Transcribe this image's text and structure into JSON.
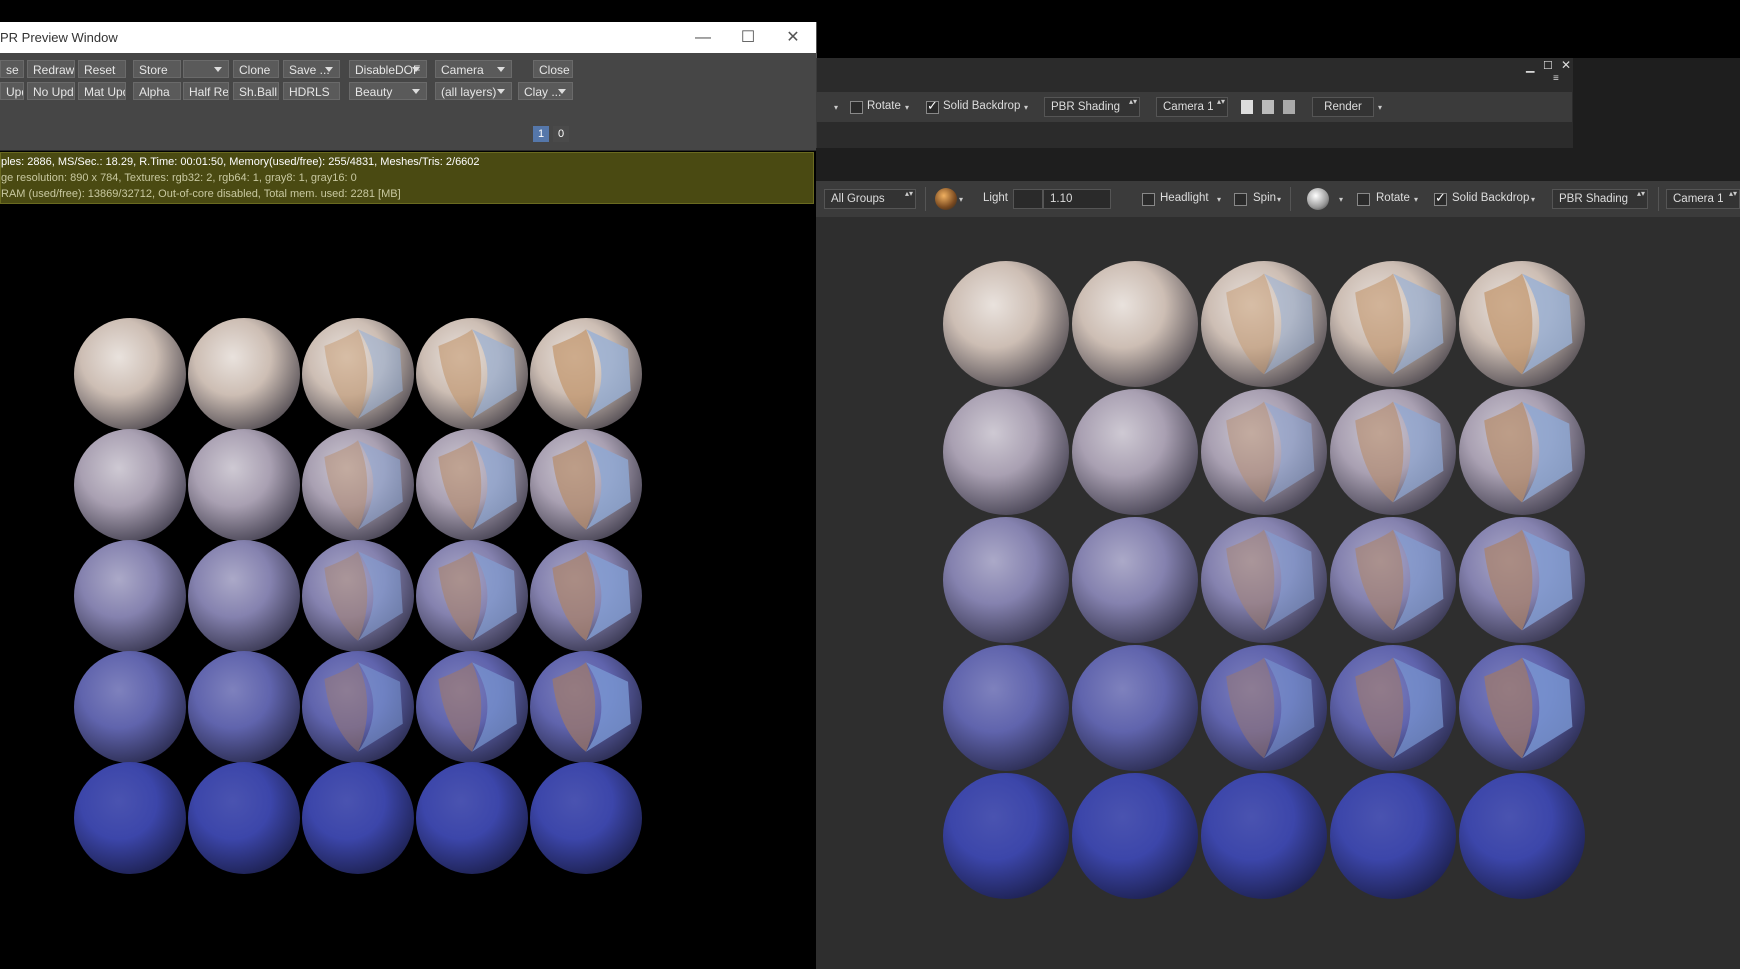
{
  "ipr_window": {
    "title": "PR Preview Window",
    "buttons_row1": [
      "se",
      "Redraw",
      "Reset",
      "Store",
      "",
      "Clone",
      "Save ...",
      "DisableDOF",
      "Camera",
      "Close"
    ],
    "buttons_row2": [
      "Upd.",
      "No Upd.",
      "Mat Upd",
      "Alpha",
      "Half Res",
      "Sh.Ball",
      "HDRLS",
      "Beauty",
      "(all layers)",
      "Clay ..."
    ],
    "pass_buttons": [
      "1",
      "0"
    ],
    "status_line1": "ples: 2886, MS/Sec.: 18.29, R.Time: 00:01:50, Memory(used/free): 255/4831, Meshes/Tris: 2/6602",
    "status_line2": "ge resolution: 890 x 784, Textures: rgb32: 2, rgb64: 1, gray8: 1, gray16: 0",
    "status_line3": "RAM (used/free): 13869/32712, Out-of-core disabled, Total mem. used: 2281 [MB]"
  },
  "viewport_back": {
    "rotate_label": "Rotate",
    "solid_backdrop_label": "Solid Backdrop",
    "shading": "PBR Shading",
    "camera": "Camera 1",
    "render_label": "Render"
  },
  "viewport_front": {
    "groups": "All Groups",
    "light_label": "Light",
    "light_value": "1.10",
    "headlight_label": "Headlight",
    "spin_label": "Spin",
    "rotate_label": "Rotate",
    "solid_backdrop_label": "Solid Backdrop",
    "shading": "PBR Shading",
    "camera": "Camera 1"
  },
  "colors": {
    "status_bg": "#4a4a12",
    "toolbar_bg": "#464646",
    "viewport_bg": "#2e2e2e",
    "accent_blue": "#5577aa"
  }
}
